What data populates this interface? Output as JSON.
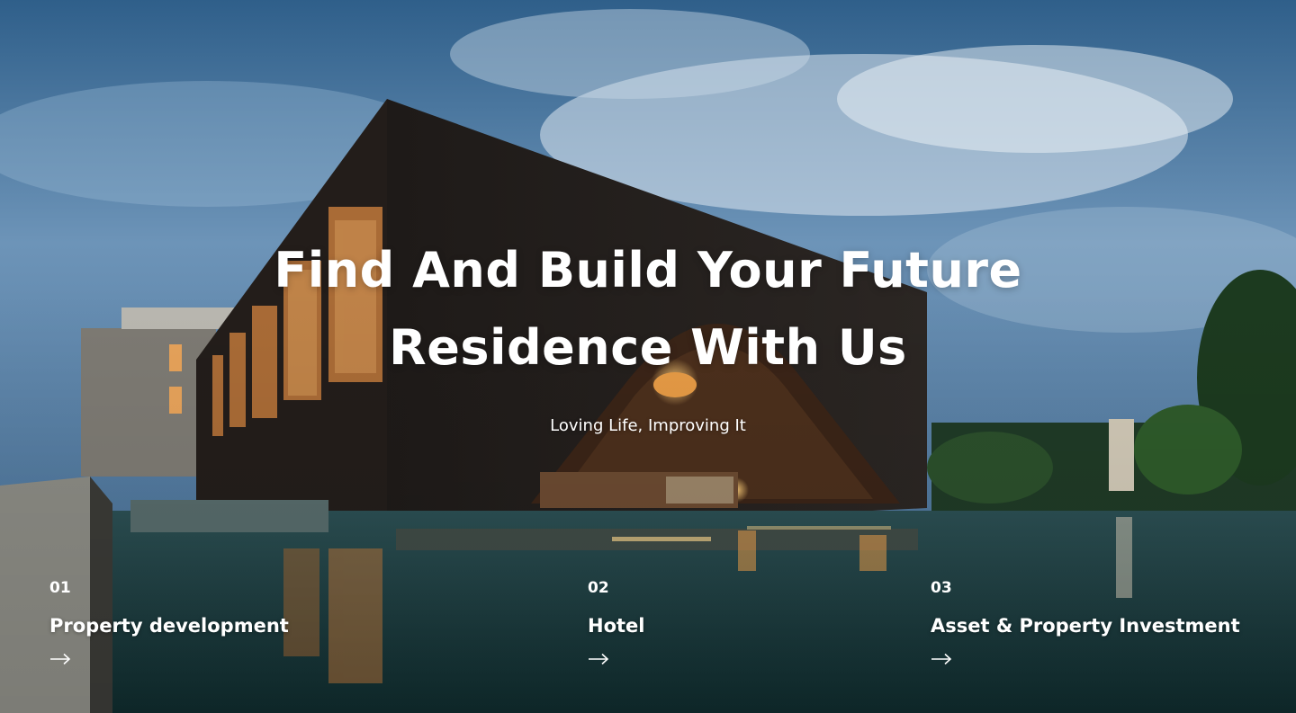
{
  "hero": {
    "headline_line1": "Find And Build Your Future",
    "headline_line2": "Residence With Us",
    "tagline": "Loving Life, Improving It"
  },
  "services": [
    {
      "number": "01",
      "title": "Property development",
      "arrow_icon": "arrow-right-icon"
    },
    {
      "number": "02",
      "title": "Hotel",
      "arrow_icon": "arrow-right-icon"
    },
    {
      "number": "03",
      "title": "Asset & Property Investment",
      "arrow_icon": "arrow-right-icon"
    }
  ],
  "colors": {
    "text": "#ffffff",
    "sky": "#3f6f98",
    "water": "#173a3c",
    "lamp_glow": "#f2a34a"
  }
}
